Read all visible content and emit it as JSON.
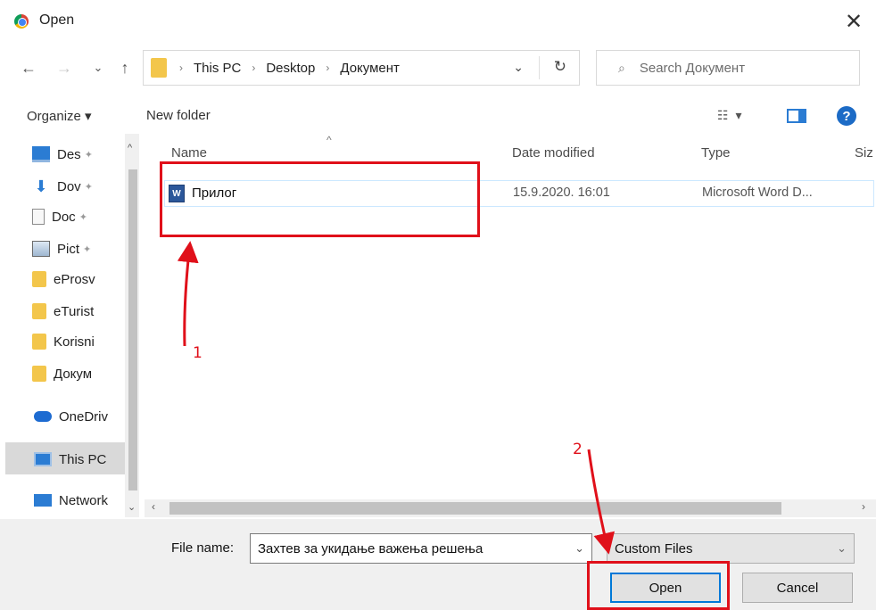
{
  "window": {
    "title": "Open",
    "close_glyph": "✕"
  },
  "nav_buttons": {
    "back": "←",
    "forward": "→",
    "recent": "⌄",
    "up": "↑"
  },
  "address": {
    "crumbs": [
      "This PC",
      "Desktop",
      "Документ"
    ],
    "separator": "›",
    "dropdown": "⌄",
    "refresh": "↻"
  },
  "search": {
    "placeholder": "Search Документ",
    "icon": "⌕"
  },
  "toolbar": {
    "organize_label": "Organize ▾",
    "new_folder_label": "New folder",
    "view_glyph": "☷ ▾",
    "help_glyph": "?"
  },
  "sidebar": {
    "items": [
      {
        "label": "Desktop",
        "icon": "desktop-icon",
        "pinned": true
      },
      {
        "label": "Downloads",
        "icon": "download-icon",
        "pinned": true
      },
      {
        "label": "Documents",
        "icon": "document-icon",
        "pinned": true
      },
      {
        "label": "Pictures",
        "icon": "pictures-icon",
        "pinned": true
      },
      {
        "label": "eProsveta",
        "icon": "folder-icon",
        "pinned": false
      },
      {
        "label": "eTurist",
        "icon": "folder-icon",
        "pinned": false
      },
      {
        "label": "Korisni",
        "icon": "folder-icon",
        "pinned": false
      },
      {
        "label": "Документ",
        "icon": "folder-icon",
        "pinned": false
      },
      {
        "label": "OneDrive",
        "icon": "onedrive-icon",
        "pinned": false
      },
      {
        "label": "This PC",
        "icon": "this-pc-icon",
        "pinned": false,
        "selected": true
      },
      {
        "label": "Network",
        "icon": "network-icon",
        "pinned": false
      }
    ],
    "display": [
      "Des",
      "Dov",
      "Doc",
      "Pict",
      "eProsv",
      "eTurist",
      "Korisni",
      "Докум",
      "OneDriv",
      "This PC",
      "Network"
    ],
    "pin_glyph": "📌"
  },
  "list": {
    "columns": {
      "name": "Name",
      "date": "Date modified",
      "type": "Type",
      "size": "Siz"
    },
    "sort_glyph": "^",
    "files": [
      {
        "name": "Прилог",
        "date_modified": "15.9.2020. 16:01",
        "type": "Microsoft Word D...",
        "icon_letter": "W"
      }
    ]
  },
  "annotations": {
    "label_1": "1",
    "label_2": "2"
  },
  "bottom": {
    "file_name_label": "File name:",
    "file_name_value": "Захтев за укидање важења решења",
    "file_type_value": "Custom Files",
    "open_label": "Open",
    "cancel_label": "Cancel",
    "dropdown": "⌄"
  },
  "colors": {
    "annotation_red": "#e0101a",
    "accent_blue": "#0078d7",
    "folder_yellow": "#f3c64b"
  }
}
